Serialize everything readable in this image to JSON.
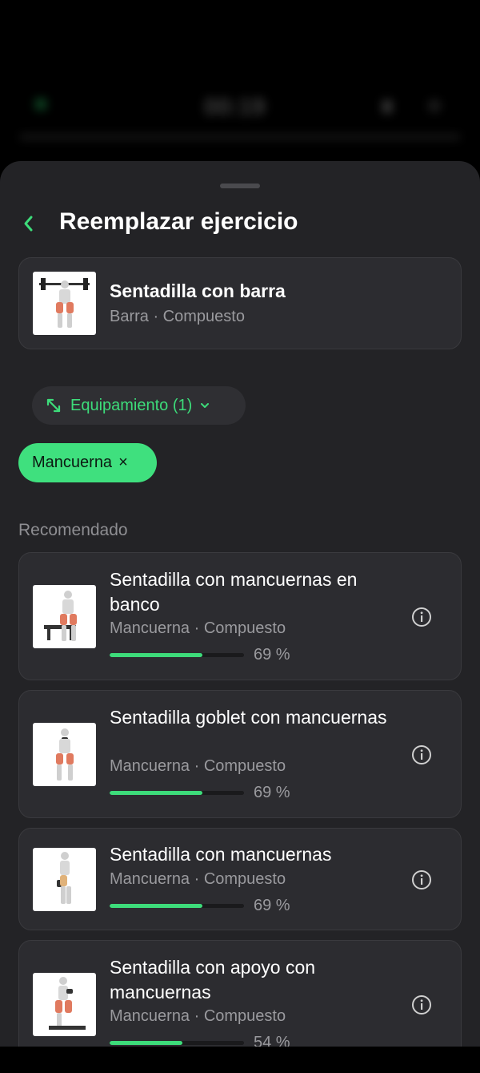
{
  "background": {
    "timer": "00:19"
  },
  "header": {
    "title": "Reemplazar ejercicio"
  },
  "current": {
    "name": "Sentadilla con barra",
    "subtitle": "Barra · Compuesto"
  },
  "filter": {
    "label": "Equipamiento (1)"
  },
  "chip": {
    "label": "Mancuerna",
    "remove": "×"
  },
  "section": {
    "label": "Recomendado"
  },
  "recommendations": [
    {
      "name": "Sentadilla con mancuernas en banco",
      "subtitle": "Mancuerna · Compuesto",
      "match": 0.69,
      "match_label": "69 %"
    },
    {
      "name": "Sentadilla goblet con mancuernas",
      "subtitle": "Mancuerna · Compuesto",
      "match": 0.69,
      "match_label": "69 %"
    },
    {
      "name": "Sentadilla con mancuernas",
      "subtitle": "Mancuerna · Compuesto",
      "match": 0.69,
      "match_label": "69 %"
    },
    {
      "name": "Sentadilla con apoyo con mancuernas",
      "subtitle": "Mancuerna · Compuesto",
      "match": 0.54,
      "match_label": "54 %"
    }
  ],
  "colors": {
    "accent": "#3ddc7a",
    "sheet": "#232326",
    "card": "#2c2c30"
  }
}
